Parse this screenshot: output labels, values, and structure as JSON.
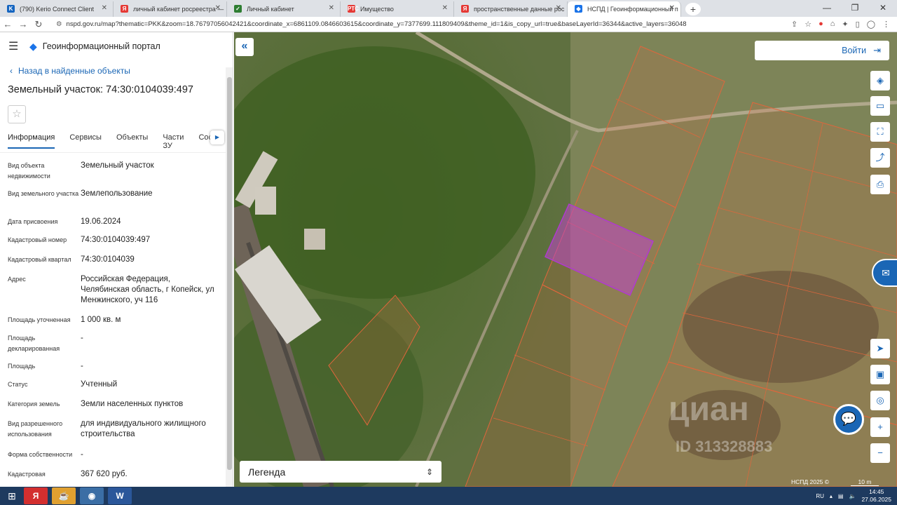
{
  "browser": {
    "tabs": [
      {
        "label": "(790) Kerio Connect Client",
        "fav": "K",
        "color": "#1565c0"
      },
      {
        "label": "личный кабинет росреестра —",
        "fav": "Я",
        "color": "#e53935"
      },
      {
        "label": "Личный кабинет",
        "fav": "✓",
        "color": "#2e7d32"
      },
      {
        "label": "Имущество",
        "fav": "РТС",
        "color": "#e53935"
      },
      {
        "label": "пространственные данные рос",
        "fav": "Я",
        "color": "#e53935"
      },
      {
        "label": "НСПД | Геоинформационный п",
        "fav": "◆",
        "color": "#1a73e8"
      }
    ],
    "active_tab": 5,
    "url": "nspd.gov.ru/map?thematic=PKK&zoom=18.76797056042421&coordinate_x=6861109.0846603615&coordinate_y=7377699.111809409&theme_id=1&is_copy_url=true&baseLayerId=36344&active_layers=36048"
  },
  "portal": {
    "title": "Геоинформационный портал",
    "back_label": "Назад в найденные объекты",
    "object_title": "Земельный участок: 74:30:0104039:497",
    "tabs": [
      "Информация",
      "Сервисы",
      "Объекты",
      "Части ЗУ",
      "Соста"
    ],
    "attributes": [
      {
        "key": "Вид объекта недвижимости",
        "value": "Земельный участок"
      },
      {
        "key": "Вид земельного участка",
        "value": "Землепользование"
      },
      {
        "key": "Дата присвоения",
        "value": "19.06.2024"
      },
      {
        "key": "Кадастровый номер",
        "value": "74:30:0104039:497"
      },
      {
        "key": "Кадастровый квартал",
        "value": "74:30:0104039"
      },
      {
        "key": "Адрес",
        "value": "Российская Федерация, Челябинская область, г Копейск, ул Менжинского, уч 116"
      },
      {
        "key": "Площадь уточненная",
        "value": "1 000 кв. м"
      },
      {
        "key": "Площадь декларированная",
        "value": "-"
      },
      {
        "key": "Площадь",
        "value": "-"
      },
      {
        "key": "Статус",
        "value": "Учтенный"
      },
      {
        "key": "Категория земель",
        "value": "Земли населенных пунктов"
      },
      {
        "key": "Вид разрешенного использования",
        "value": "для индивидуального жилищного строительства"
      },
      {
        "key": "Форма собственности",
        "value": "-"
      },
      {
        "key": "Кадастровая",
        "value": "367 620 руб."
      }
    ]
  },
  "map": {
    "login_label": "Войти",
    "legend_label": "Легенда",
    "copyright": "НСПД 2025 ©",
    "scale": "10 m",
    "watermark": "циан",
    "watermark_id": "ID 313328883",
    "highlight_color": "#b03ad0",
    "parcel_color": "#e0663c"
  },
  "taskbar": {
    "lang": "RU",
    "time": "14:45",
    "date": "27.06.2025"
  }
}
